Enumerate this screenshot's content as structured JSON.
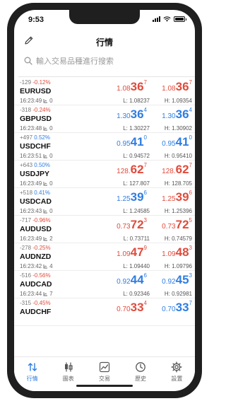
{
  "status_bar": {
    "time": "9:53"
  },
  "header": {
    "title": "行情"
  },
  "search": {
    "placeholder": "輸入交易品種進行搜索"
  },
  "quotes": [
    {
      "change_points": "-129",
      "change_percent": "-0.12%",
      "direction": "down",
      "symbol": "EURUSD",
      "time": "16:23:49",
      "spread": "0",
      "bid": {
        "prefix": "1.08",
        "big": "36",
        "sup": "7",
        "dir": "down"
      },
      "ask": {
        "prefix": "1.08",
        "big": "36",
        "sup": "7",
        "dir": "down"
      },
      "low": "L: 1.08237",
      "high": "H: 1.09354"
    },
    {
      "change_points": "-318",
      "change_percent": "-0.24%",
      "direction": "down",
      "symbol": "GBPUSD",
      "time": "16:23:48",
      "spread": "0",
      "bid": {
        "prefix": "1.30",
        "big": "36",
        "sup": "4",
        "dir": "up"
      },
      "ask": {
        "prefix": "1.30",
        "big": "36",
        "sup": "4",
        "dir": "up"
      },
      "low": "L: 1.30227",
      "high": "H: 1.30902"
    },
    {
      "change_points": "+497",
      "change_percent": "0.52%",
      "direction": "up",
      "symbol": "USDCHF",
      "time": "16:23:51",
      "spread": "0",
      "bid": {
        "prefix": "0.95",
        "big": "41",
        "sup": "0",
        "dir": "up"
      },
      "ask": {
        "prefix": "0.95",
        "big": "41",
        "sup": "0",
        "dir": "up"
      },
      "low": "L: 0.94572",
      "high": "H: 0.95410"
    },
    {
      "change_points": "+643",
      "change_percent": "0.50%",
      "direction": "up",
      "symbol": "USDJPY",
      "time": "16:23:49",
      "spread": "0",
      "bid": {
        "prefix": "128.",
        "big": "62",
        "sup": "7",
        "dir": "down"
      },
      "ask": {
        "prefix": "128.",
        "big": "62",
        "sup": "7",
        "dir": "down"
      },
      "low": "L: 127.807",
      "high": "H: 128.705"
    },
    {
      "change_points": "+518",
      "change_percent": "0.41%",
      "direction": "up",
      "symbol": "USDCAD",
      "time": "16:23:43",
      "spread": "0",
      "bid": {
        "prefix": "1.25",
        "big": "39",
        "sup": "6",
        "dir": "up"
      },
      "ask": {
        "prefix": "1.25",
        "big": "39",
        "sup": "6",
        "dir": "down"
      },
      "low": "L: 1.24585",
      "high": "H: 1.25396"
    },
    {
      "change_points": "-717",
      "change_percent": "-0.96%",
      "direction": "down",
      "symbol": "AUDUSD",
      "time": "16:23:49",
      "spread": "2",
      "bid": {
        "prefix": "0.73",
        "big": "72",
        "sup": "3",
        "dir": "down"
      },
      "ask": {
        "prefix": "0.73",
        "big": "72",
        "sup": "5",
        "dir": "down"
      },
      "low": "L: 0.73711",
      "high": "H: 0.74579"
    },
    {
      "change_points": "-278",
      "change_percent": "-0.25%",
      "direction": "down",
      "symbol": "AUDNZD",
      "time": "16:23:42",
      "spread": "4",
      "bid": {
        "prefix": "1.09",
        "big": "47",
        "sup": "9",
        "dir": "down"
      },
      "ask": {
        "prefix": "1.09",
        "big": "48",
        "sup": "3",
        "dir": "down"
      },
      "low": "L: 1.09440",
      "high": "H: 1.09796"
    },
    {
      "change_points": "-516",
      "change_percent": "-0.56%",
      "direction": "down",
      "symbol": "AUDCAD",
      "time": "16:23:44",
      "spread": "7",
      "bid": {
        "prefix": "0.92",
        "big": "44",
        "sup": "6",
        "dir": "up"
      },
      "ask": {
        "prefix": "0.92",
        "big": "45",
        "sup": "3",
        "dir": "up"
      },
      "low": "L: 0.92346",
      "high": "H: 0.92981"
    },
    {
      "change_points": "-315",
      "change_percent": "-0.45%",
      "direction": "down",
      "symbol": "AUDCHF",
      "time": "",
      "spread": "",
      "bid": {
        "prefix": "0.70",
        "big": "33",
        "sup": "4",
        "dir": "down"
      },
      "ask": {
        "prefix": "0.70",
        "big": "33",
        "sup": "7",
        "dir": "up"
      },
      "low": "",
      "high": ""
    }
  ],
  "tabs": [
    {
      "label": "行情",
      "icon": "arrows-updown-icon",
      "active": true
    },
    {
      "label": "圖表",
      "icon": "candlestick-icon",
      "active": false
    },
    {
      "label": "交易",
      "icon": "trade-chart-icon",
      "active": false
    },
    {
      "label": "歷史",
      "icon": "history-clock-icon",
      "active": false
    },
    {
      "label": "設置",
      "icon": "gear-icon",
      "active": false
    }
  ],
  "colors": {
    "up": "#2f7de1",
    "down": "#e04b3c",
    "active_tab": "#2f7de1"
  }
}
